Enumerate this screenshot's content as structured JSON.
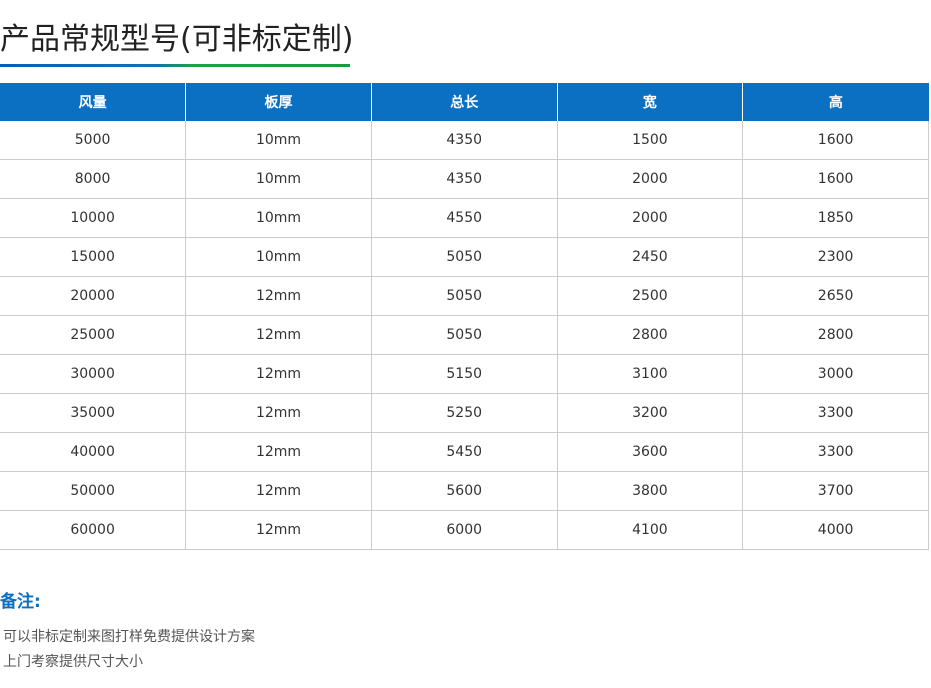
{
  "title": "产品常规型号(可非标定制)",
  "table": {
    "headers": [
      "风量",
      "板厚",
      "总长",
      "宽",
      "高"
    ],
    "rows": [
      [
        "5000",
        "10mm",
        "4350",
        "1500",
        "1600"
      ],
      [
        "8000",
        "10mm",
        "4350",
        "2000",
        "1600"
      ],
      [
        "10000",
        "10mm",
        "4550",
        "2000",
        "1850"
      ],
      [
        "15000",
        "10mm",
        "5050",
        "2450",
        "2300"
      ],
      [
        "20000",
        "12mm",
        "5050",
        "2500",
        "2650"
      ],
      [
        "25000",
        "12mm",
        "5050",
        "2800",
        "2800"
      ],
      [
        "30000",
        "12mm",
        "5150",
        "3100",
        "3000"
      ],
      [
        "35000",
        "12mm",
        "5250",
        "3200",
        "3300"
      ],
      [
        "40000",
        "12mm",
        "5450",
        "3600",
        "3300"
      ],
      [
        "50000",
        "12mm",
        "5600",
        "3800",
        "3700"
      ],
      [
        "60000",
        "12mm",
        "6000",
        "4100",
        "4000"
      ]
    ]
  },
  "notes": {
    "heading": "备注:",
    "lines": [
      "可以非标定制来图打样免费提供设计方案",
      "上门考察提供尺寸大小"
    ]
  },
  "colors": {
    "header_bg": "#0c70c2",
    "accent_blue": "#0c5fad",
    "accent_green": "#1f9a3b",
    "notes_heading": "#0c70c2"
  }
}
